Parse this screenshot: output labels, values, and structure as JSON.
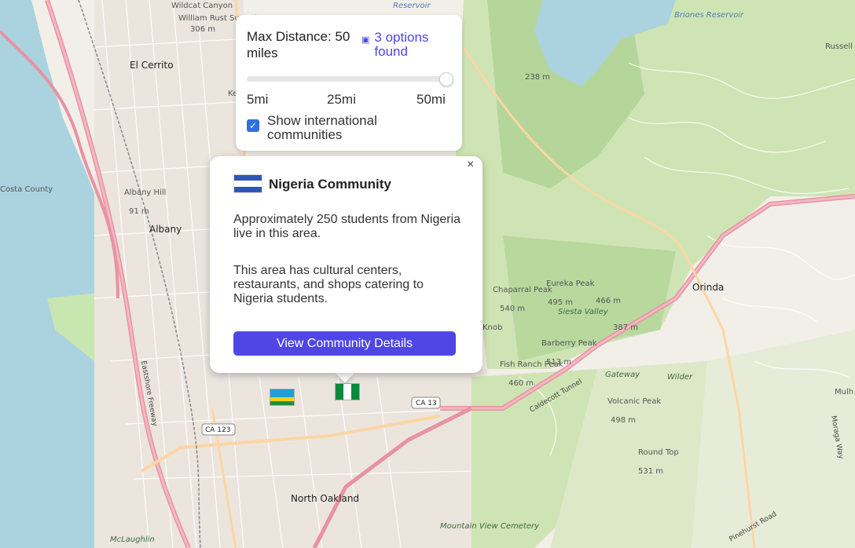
{
  "filter_panel": {
    "title": "Max Distance: 50 miles",
    "options_found": "3 options found",
    "options_icon": "map-icon",
    "slider_value_fraction": 1.0,
    "tick_min": "5mi",
    "tick_mid": "25mi",
    "tick_max": "50mi",
    "checkbox_checked": true,
    "checkbox_label": "Show international communities",
    "accent_color": "#4f46e5"
  },
  "popup": {
    "close_symbol": "×",
    "flag_colors": [
      "#2f55b8",
      "#ffffff",
      "#2f55b8"
    ],
    "title": "Nigeria Community",
    "paragraph1": "Approximately 250 students from Nigeria live in this area.",
    "paragraph2": "This area has cultural centers, restaurants, and shops catering to Nigeria students.",
    "button_label": "View Community Details"
  },
  "markers": [
    {
      "name": "rwanda-flag-marker",
      "colors": [
        "#20a0d8",
        "#f7d117",
        "#1e8f3c"
      ]
    },
    {
      "name": "nigeria-flag-marker",
      "colors": [
        "#0a8a3a",
        "#ffffff",
        "#0a8a3a"
      ]
    }
  ],
  "map_labels": {
    "wildcat_top": "Wildcat Canyon",
    "rust_summit": "William Rust Summit",
    "rust_elev": "306 m",
    "el_cerrito": "El Cerrito",
    "reservoir": "Reservoir",
    "briones": "Briones Reservoir",
    "russell": "Russell Research Station",
    "albany_hill": "Albany Hill",
    "albany_hill_elev": "91 m",
    "albany": "Albany",
    "costa": "Costa County",
    "elev_238": "238 m",
    "orinda": "Orinda",
    "chaparral": "Chaparral Peak",
    "chaparral_elev": "540 m",
    "eureka": "Eureka Peak",
    "eureka_elev": "495 m",
    "elev_466": "466 m",
    "siesta": "Siesta Valley",
    "elev_387": "387 m",
    "knob": "Knob",
    "barberry": "Barberry Peak",
    "barberry_elev": "513 m",
    "fishranch": "Fish Ranch Peak",
    "fishranch_elev": "460 m",
    "gateway": "Gateway",
    "wilder": "Wilder",
    "volcanic": "Volcanic Peak",
    "volcanic_elev": "498 m",
    "round_top": "Round Top",
    "round_top_elev": "531 m",
    "caldecott": "Caldecott Tunnel",
    "ca13": "CA 13",
    "ca123": "CA 123",
    "north_oakland": "North Oakland",
    "mountain_cemetery": "Mountain View Cemetery",
    "mclaughlin": "McLaughlin",
    "eastshore": "Eastshore Freeway",
    "moraga": "Moraga Way",
    "pinehurst": "Pinehurst Road",
    "mulh": "Mulh",
    "ke": "Ke"
  }
}
